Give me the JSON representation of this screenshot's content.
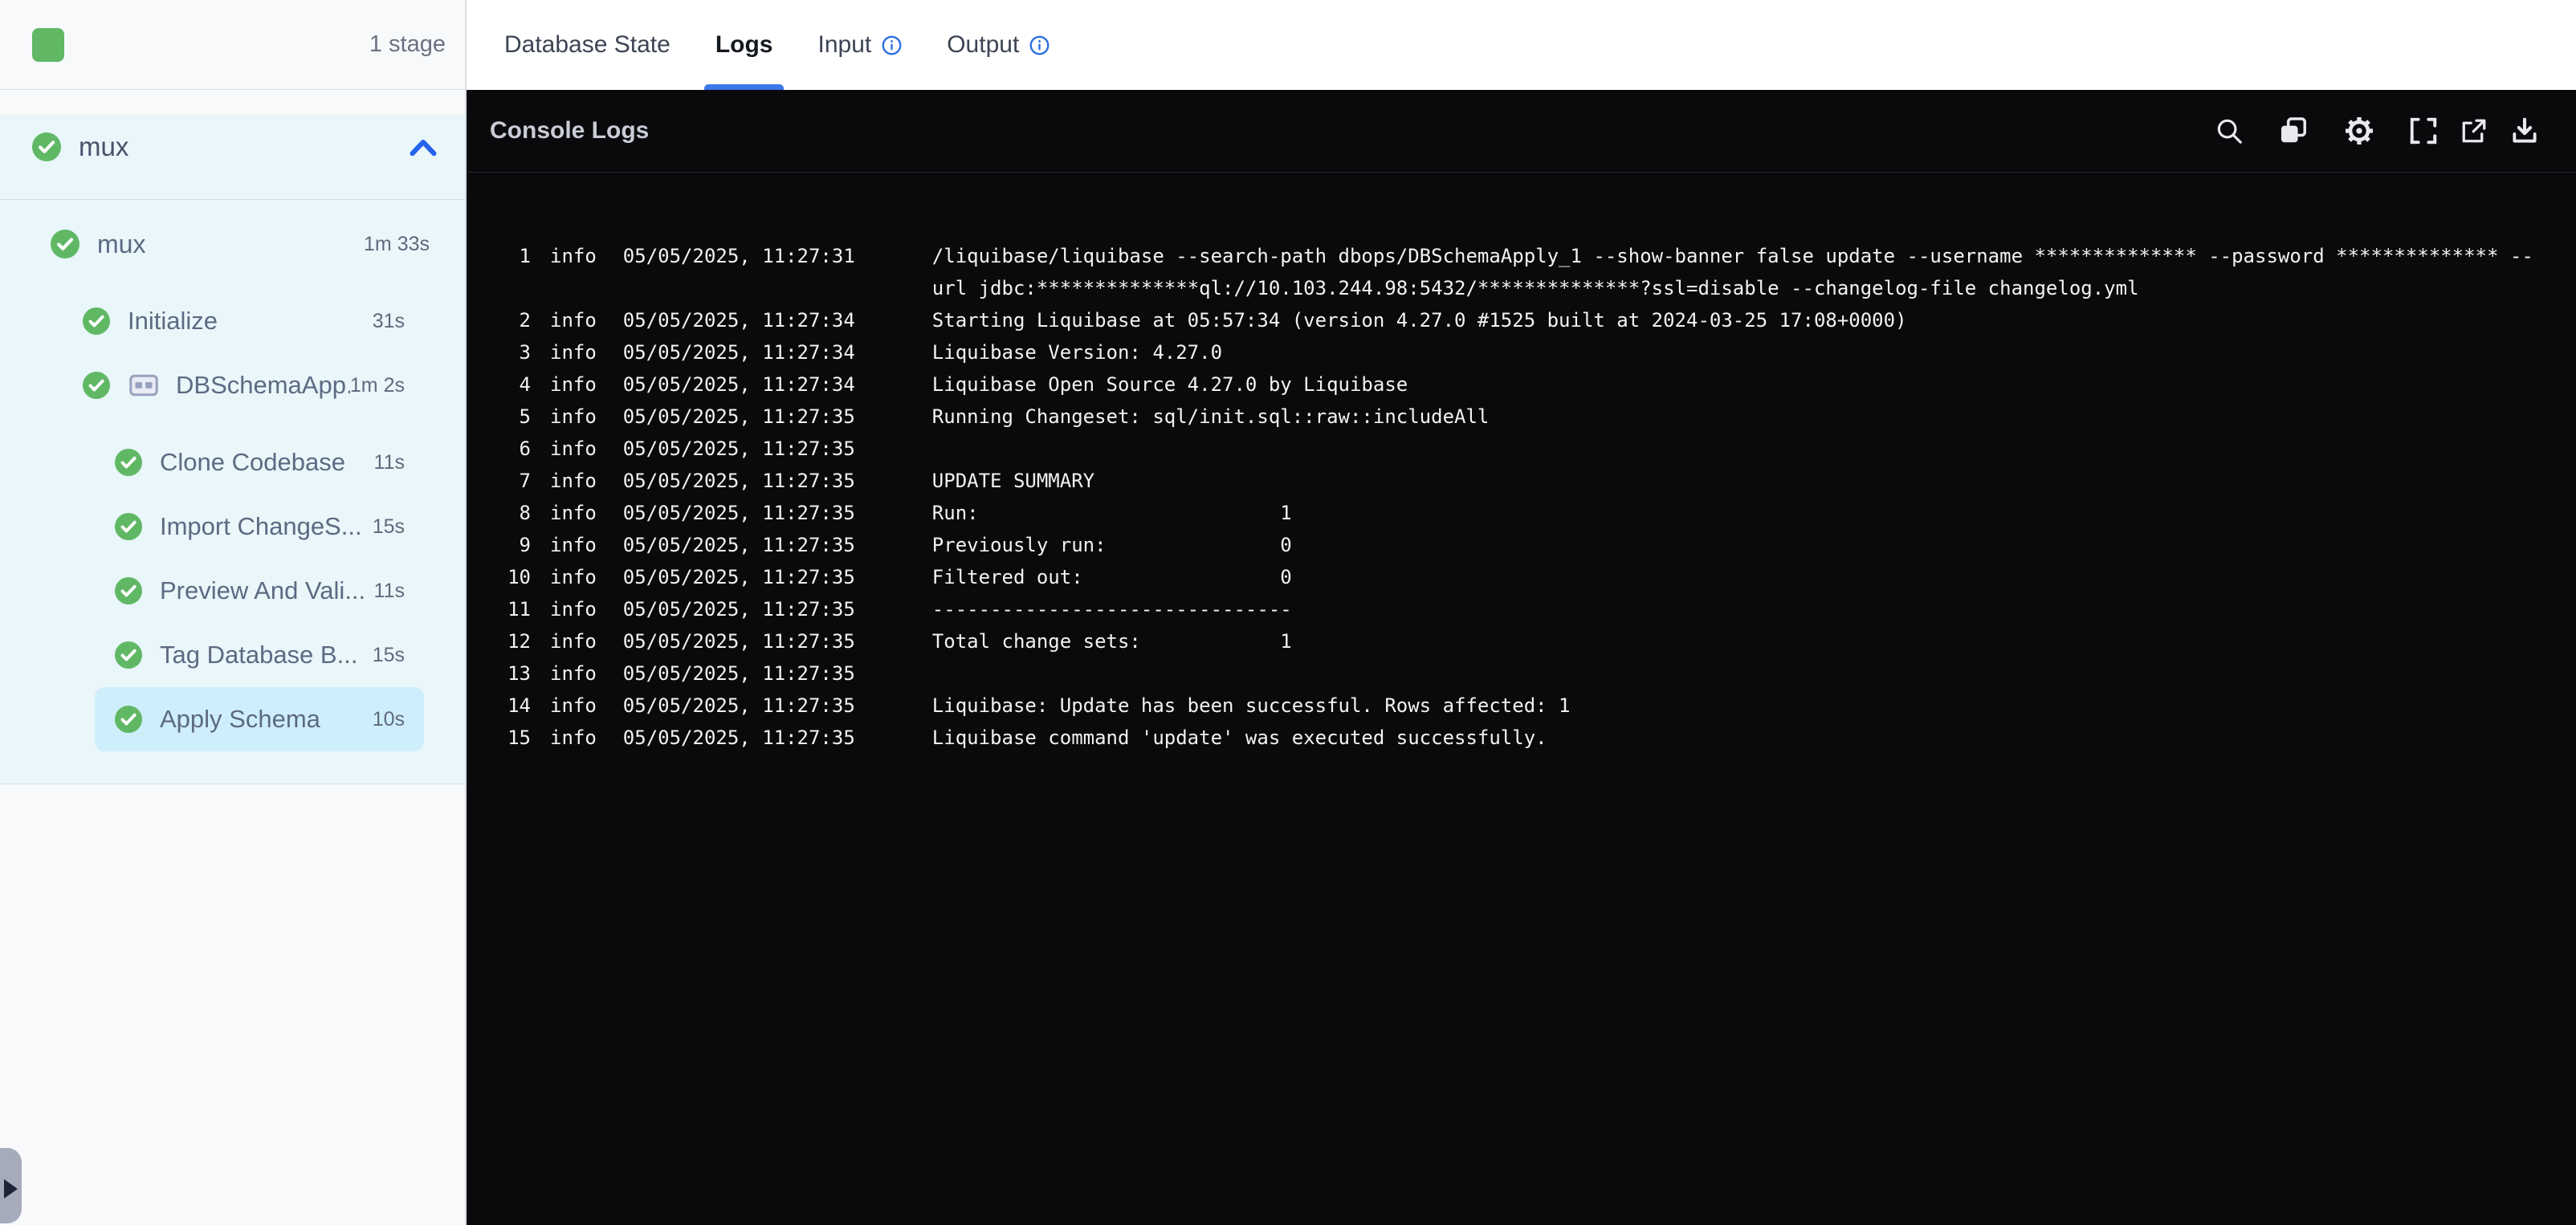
{
  "sidebar": {
    "stage_count": "1 stage",
    "group_header": {
      "label": "mux"
    },
    "stage_row": {
      "label": "mux",
      "duration": "1m 33s"
    },
    "steps": [
      {
        "label": "Initialize",
        "duration": "31s",
        "level": 1,
        "group_icon": false,
        "selected": false,
        "gap": true
      },
      {
        "label": "DBSchemaApp...",
        "duration": "1m 2s",
        "level": 1,
        "group_icon": true,
        "selected": false,
        "gap": false
      },
      {
        "label": "Clone Codebase",
        "duration": "11s",
        "level": 2,
        "group_icon": false,
        "selected": false,
        "gap": true
      },
      {
        "label": "Import ChangeS...",
        "duration": "15s",
        "level": 2,
        "group_icon": false,
        "selected": false,
        "gap": false
      },
      {
        "label": "Preview And Vali...",
        "duration": "11s",
        "level": 2,
        "group_icon": false,
        "selected": false,
        "gap": false
      },
      {
        "label": "Tag Database B...",
        "duration": "15s",
        "level": 2,
        "group_icon": false,
        "selected": false,
        "gap": false
      },
      {
        "label": "Apply Schema",
        "duration": "10s",
        "level": 2,
        "group_icon": false,
        "selected": true,
        "gap": false
      }
    ]
  },
  "tabs": {
    "items": [
      {
        "label": "Database State",
        "active": false,
        "info": false
      },
      {
        "label": "Logs",
        "active": true,
        "info": false
      },
      {
        "label": "Input",
        "active": false,
        "info": true
      },
      {
        "label": "Output",
        "active": false,
        "info": true
      }
    ]
  },
  "console": {
    "title": "Console Logs",
    "toolbar_icons": [
      "search-icon",
      "copy-icon",
      "settings-icon",
      "fullscreen-icon",
      "open-in-new-icon",
      "download-icon"
    ],
    "logs": [
      {
        "n": "1",
        "level": "info",
        "time": "05/05/2025, 11:27:31",
        "message": "/liquibase/liquibase --search-path dbops/DBSchemaApply_1 --show-banner false update --username ************** --password ************** --\nurl jdbc:**************ql://10.103.244.98:5432/**************?ssl=disable --changelog-file changelog.yml"
      },
      {
        "n": "2",
        "level": "info",
        "time": "05/05/2025, 11:27:34",
        "message": "Starting Liquibase at 05:57:34 (version 4.27.0 #1525 built at 2024-03-25 17:08+0000)"
      },
      {
        "n": "3",
        "level": "info",
        "time": "05/05/2025, 11:27:34",
        "message": "Liquibase Version: 4.27.0"
      },
      {
        "n": "4",
        "level": "info",
        "time": "05/05/2025, 11:27:34",
        "message": "Liquibase Open Source 4.27.0 by Liquibase"
      },
      {
        "n": "5",
        "level": "info",
        "time": "05/05/2025, 11:27:35",
        "message": "Running Changeset: sql/init.sql::raw::includeAll"
      },
      {
        "n": "6",
        "level": "info",
        "time": "05/05/2025, 11:27:35",
        "message": ""
      },
      {
        "n": "7",
        "level": "info",
        "time": "05/05/2025, 11:27:35",
        "message": "UPDATE SUMMARY"
      },
      {
        "n": "8",
        "level": "info",
        "time": "05/05/2025, 11:27:35",
        "message": "Run:                          1"
      },
      {
        "n": "9",
        "level": "info",
        "time": "05/05/2025, 11:27:35",
        "message": "Previously run:               0"
      },
      {
        "n": "10",
        "level": "info",
        "time": "05/05/2025, 11:27:35",
        "message": "Filtered out:                 0"
      },
      {
        "n": "11",
        "level": "info",
        "time": "05/05/2025, 11:27:35",
        "message": "-------------------------------"
      },
      {
        "n": "12",
        "level": "info",
        "time": "05/05/2025, 11:27:35",
        "message": "Total change sets:            1"
      },
      {
        "n": "13",
        "level": "info",
        "time": "05/05/2025, 11:27:35",
        "message": ""
      },
      {
        "n": "14",
        "level": "info",
        "time": "05/05/2025, 11:27:35",
        "message": "Liquibase: Update has been successful. Rows affected: 1"
      },
      {
        "n": "15",
        "level": "info",
        "time": "05/05/2025, 11:27:35",
        "message": "Liquibase command 'update' was executed successfully."
      }
    ]
  },
  "colors": {
    "success_green": "#60b865",
    "accent_blue": "#3b77e6",
    "selected_step": "#cfeefb",
    "sidebar_section_bg": "#e9f6fa",
    "console_bg": "#0a0a0c"
  }
}
